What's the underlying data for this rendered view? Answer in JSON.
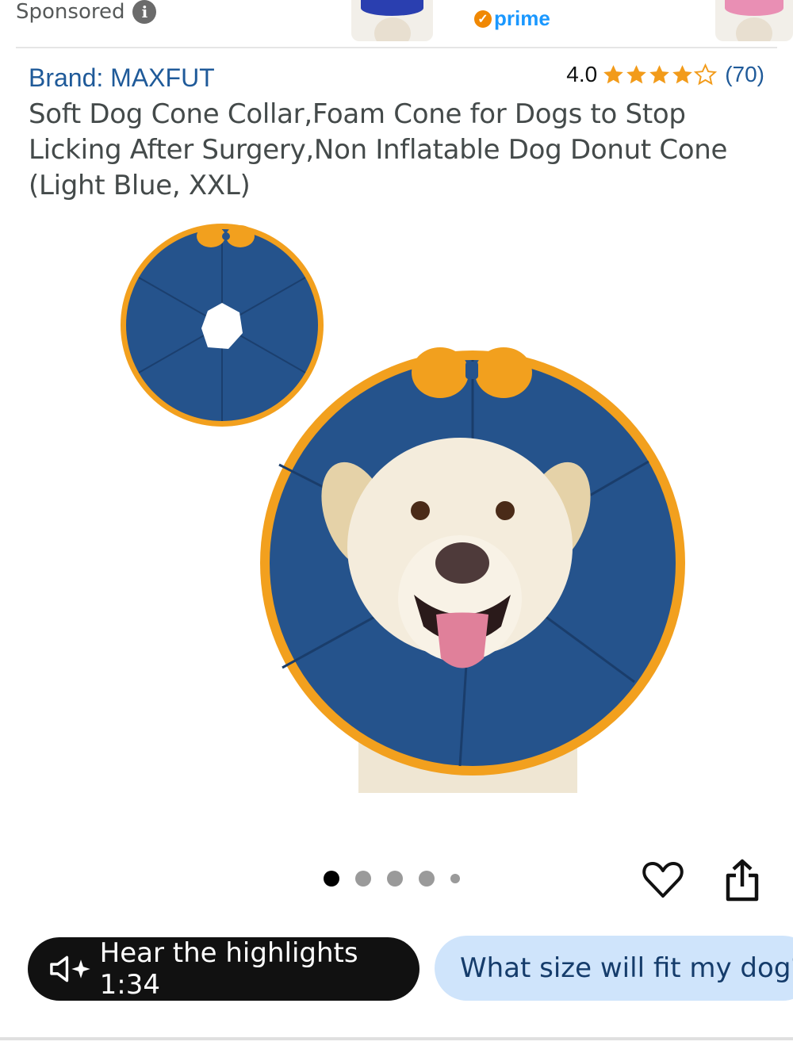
{
  "header": {
    "sponsored_label": "Sponsored",
    "info_icon": "info-icon",
    "prime_label": "prime",
    "prime_icon": "prime-check-icon"
  },
  "product": {
    "brand": "Brand: MAXFUT",
    "rating_value": "4.0",
    "rating_stars": 4,
    "rating_max": 5,
    "rating_count": "(70)",
    "title": "Soft Dog Cone Collar,Foam Cone for Dogs to Stop Licking After Surgery,Non Inflatable Dog Donut Cone (Light Blue, XXL)",
    "colors": {
      "collar_blue": "#25538c",
      "collar_trim": "#f2a01e",
      "link_blue": "#1f5a99",
      "star_orange": "#f29b1a"
    }
  },
  "carousel": {
    "image_count": 5,
    "active_index": 0
  },
  "actions": {
    "heart_icon": "heart-icon",
    "share_icon": "share-icon"
  },
  "bottom": {
    "hear_highlights": "Hear the highlights 1:34",
    "speaker_icon": "speaker-sparkle-icon",
    "ask_question": "What size will fit my dog?"
  }
}
